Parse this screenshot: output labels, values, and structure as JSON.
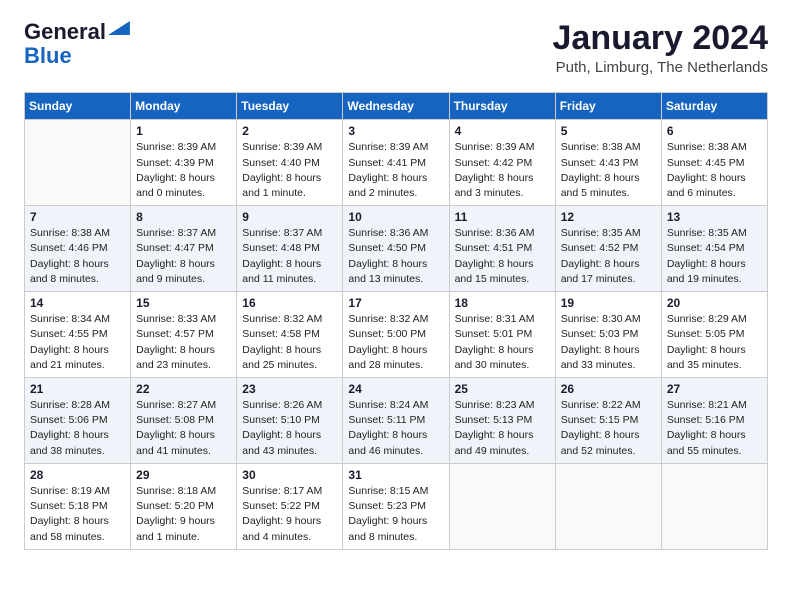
{
  "header": {
    "logo_line1": "General",
    "logo_line2": "Blue",
    "month": "January 2024",
    "location": "Puth, Limburg, The Netherlands"
  },
  "days_of_week": [
    "Sunday",
    "Monday",
    "Tuesday",
    "Wednesday",
    "Thursday",
    "Friday",
    "Saturday"
  ],
  "weeks": [
    [
      {
        "day": "",
        "info": ""
      },
      {
        "day": "1",
        "info": "Sunrise: 8:39 AM\nSunset: 4:39 PM\nDaylight: 8 hours\nand 0 minutes."
      },
      {
        "day": "2",
        "info": "Sunrise: 8:39 AM\nSunset: 4:40 PM\nDaylight: 8 hours\nand 1 minute."
      },
      {
        "day": "3",
        "info": "Sunrise: 8:39 AM\nSunset: 4:41 PM\nDaylight: 8 hours\nand 2 minutes."
      },
      {
        "day": "4",
        "info": "Sunrise: 8:39 AM\nSunset: 4:42 PM\nDaylight: 8 hours\nand 3 minutes."
      },
      {
        "day": "5",
        "info": "Sunrise: 8:38 AM\nSunset: 4:43 PM\nDaylight: 8 hours\nand 5 minutes."
      },
      {
        "day": "6",
        "info": "Sunrise: 8:38 AM\nSunset: 4:45 PM\nDaylight: 8 hours\nand 6 minutes."
      }
    ],
    [
      {
        "day": "7",
        "info": "Sunrise: 8:38 AM\nSunset: 4:46 PM\nDaylight: 8 hours\nand 8 minutes."
      },
      {
        "day": "8",
        "info": "Sunrise: 8:37 AM\nSunset: 4:47 PM\nDaylight: 8 hours\nand 9 minutes."
      },
      {
        "day": "9",
        "info": "Sunrise: 8:37 AM\nSunset: 4:48 PM\nDaylight: 8 hours\nand 11 minutes."
      },
      {
        "day": "10",
        "info": "Sunrise: 8:36 AM\nSunset: 4:50 PM\nDaylight: 8 hours\nand 13 minutes."
      },
      {
        "day": "11",
        "info": "Sunrise: 8:36 AM\nSunset: 4:51 PM\nDaylight: 8 hours\nand 15 minutes."
      },
      {
        "day": "12",
        "info": "Sunrise: 8:35 AM\nSunset: 4:52 PM\nDaylight: 8 hours\nand 17 minutes."
      },
      {
        "day": "13",
        "info": "Sunrise: 8:35 AM\nSunset: 4:54 PM\nDaylight: 8 hours\nand 19 minutes."
      }
    ],
    [
      {
        "day": "14",
        "info": "Sunrise: 8:34 AM\nSunset: 4:55 PM\nDaylight: 8 hours\nand 21 minutes."
      },
      {
        "day": "15",
        "info": "Sunrise: 8:33 AM\nSunset: 4:57 PM\nDaylight: 8 hours\nand 23 minutes."
      },
      {
        "day": "16",
        "info": "Sunrise: 8:32 AM\nSunset: 4:58 PM\nDaylight: 8 hours\nand 25 minutes."
      },
      {
        "day": "17",
        "info": "Sunrise: 8:32 AM\nSunset: 5:00 PM\nDaylight: 8 hours\nand 28 minutes."
      },
      {
        "day": "18",
        "info": "Sunrise: 8:31 AM\nSunset: 5:01 PM\nDaylight: 8 hours\nand 30 minutes."
      },
      {
        "day": "19",
        "info": "Sunrise: 8:30 AM\nSunset: 5:03 PM\nDaylight: 8 hours\nand 33 minutes."
      },
      {
        "day": "20",
        "info": "Sunrise: 8:29 AM\nSunset: 5:05 PM\nDaylight: 8 hours\nand 35 minutes."
      }
    ],
    [
      {
        "day": "21",
        "info": "Sunrise: 8:28 AM\nSunset: 5:06 PM\nDaylight: 8 hours\nand 38 minutes."
      },
      {
        "day": "22",
        "info": "Sunrise: 8:27 AM\nSunset: 5:08 PM\nDaylight: 8 hours\nand 41 minutes."
      },
      {
        "day": "23",
        "info": "Sunrise: 8:26 AM\nSunset: 5:10 PM\nDaylight: 8 hours\nand 43 minutes."
      },
      {
        "day": "24",
        "info": "Sunrise: 8:24 AM\nSunset: 5:11 PM\nDaylight: 8 hours\nand 46 minutes."
      },
      {
        "day": "25",
        "info": "Sunrise: 8:23 AM\nSunset: 5:13 PM\nDaylight: 8 hours\nand 49 minutes."
      },
      {
        "day": "26",
        "info": "Sunrise: 8:22 AM\nSunset: 5:15 PM\nDaylight: 8 hours\nand 52 minutes."
      },
      {
        "day": "27",
        "info": "Sunrise: 8:21 AM\nSunset: 5:16 PM\nDaylight: 8 hours\nand 55 minutes."
      }
    ],
    [
      {
        "day": "28",
        "info": "Sunrise: 8:19 AM\nSunset: 5:18 PM\nDaylight: 8 hours\nand 58 minutes."
      },
      {
        "day": "29",
        "info": "Sunrise: 8:18 AM\nSunset: 5:20 PM\nDaylight: 9 hours\nand 1 minute."
      },
      {
        "day": "30",
        "info": "Sunrise: 8:17 AM\nSunset: 5:22 PM\nDaylight: 9 hours\nand 4 minutes."
      },
      {
        "day": "31",
        "info": "Sunrise: 8:15 AM\nSunset: 5:23 PM\nDaylight: 9 hours\nand 8 minutes."
      },
      {
        "day": "",
        "info": ""
      },
      {
        "day": "",
        "info": ""
      },
      {
        "day": "",
        "info": ""
      }
    ]
  ]
}
